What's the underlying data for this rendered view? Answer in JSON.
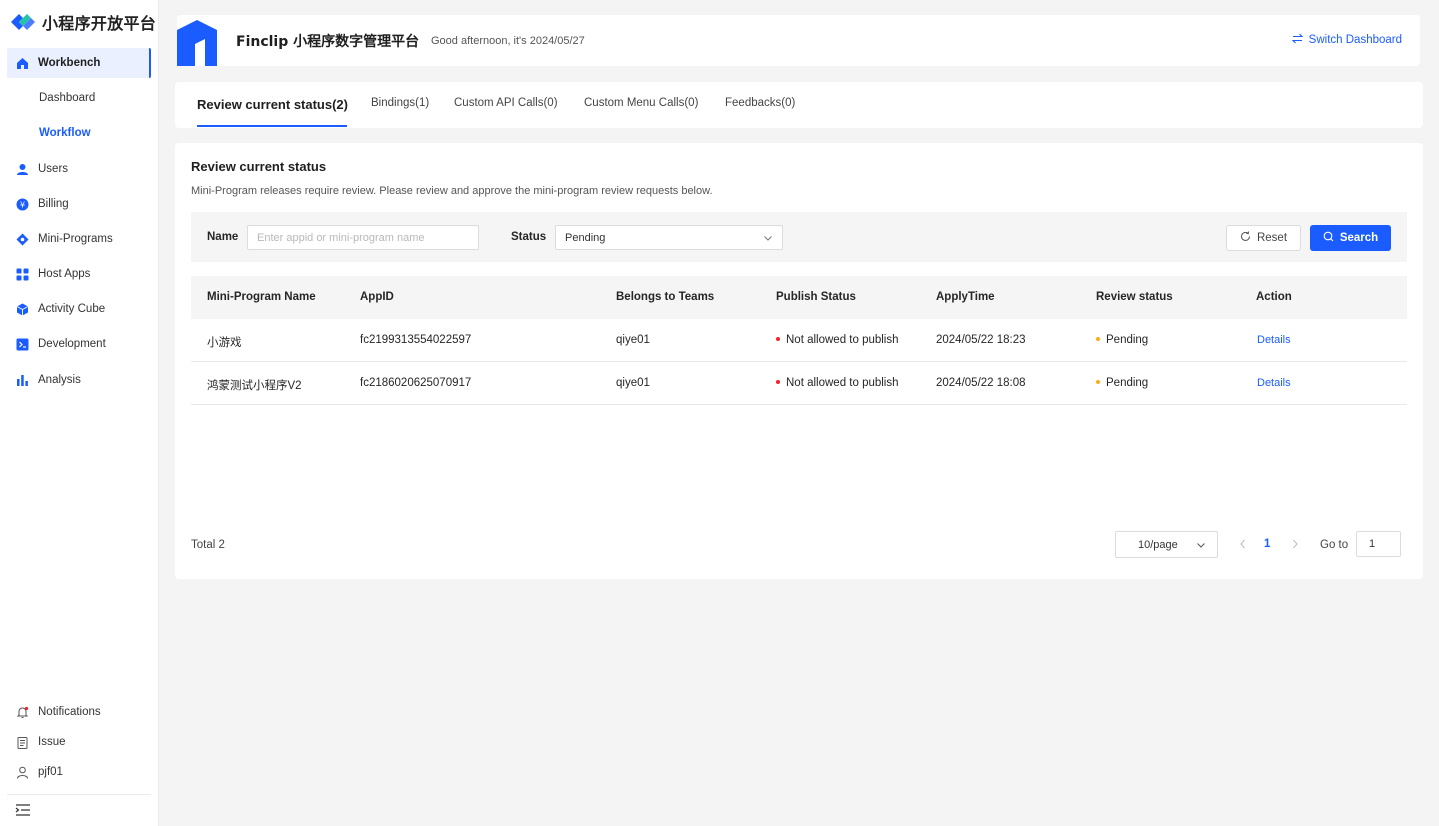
{
  "app": {
    "logo_text": "小程序开放平台"
  },
  "sidebar": {
    "workbench": "Workbench",
    "dashboard": "Dashboard",
    "workflow": "Workflow",
    "items": [
      {
        "label": "Users",
        "icon": "users-icon"
      },
      {
        "label": "Billing",
        "icon": "billing-icon"
      },
      {
        "label": "Mini-Programs",
        "icon": "mini-programs-icon"
      },
      {
        "label": "Host Apps",
        "icon": "host-apps-icon"
      },
      {
        "label": "Activity Cube",
        "icon": "cube-icon"
      },
      {
        "label": "Development",
        "icon": "terminal-icon"
      },
      {
        "label": "Analysis",
        "icon": "bar-chart-icon"
      }
    ],
    "bottom": [
      {
        "label": "Notifications",
        "icon": "bell-icon"
      },
      {
        "label": "Issue",
        "icon": "clipboard-icon"
      },
      {
        "label": "pjf01",
        "icon": "user-icon"
      }
    ]
  },
  "header": {
    "title": "Finclip 小程序数字管理平台",
    "greeting": "Good afternoon, it's  2024/05/27",
    "switch_label": "Switch Dashboard"
  },
  "tabs": [
    {
      "label": "Review current status(2)",
      "active": true
    },
    {
      "label": "Bindings(1)"
    },
    {
      "label": "Custom API Calls(0)"
    },
    {
      "label": "Custom Menu Calls(0)"
    },
    {
      "label": "Feedbacks(0)"
    }
  ],
  "section": {
    "title": "Review current status",
    "description": "Mini-Program releases require review. Please review and approve the mini-program review requests below."
  },
  "filters": {
    "name_label": "Name",
    "name_placeholder": "Enter appid or mini-program name",
    "status_label": "Status",
    "status_value": "Pending",
    "reset_label": "Reset",
    "search_label": "Search"
  },
  "table": {
    "columns": [
      "Mini-Program Name",
      "AppID",
      "Belongs to Teams",
      "Publish Status",
      "ApplyTime",
      "Review status",
      "Action"
    ],
    "rows": [
      {
        "name": "小游戏",
        "appid": "fc2199313554022597",
        "team": "qiye01",
        "publish": "Not allowed to publish",
        "apply_time": "2024/05/22 18:23",
        "review": "Pending",
        "action": "Details"
      },
      {
        "name": "鸿蒙测试小程序V2",
        "appid": "fc2186020625070917",
        "team": "qiye01",
        "publish": "Not allowed to publish",
        "apply_time": "2024/05/22 18:08",
        "review": "Pending",
        "action": "Details"
      }
    ]
  },
  "pagination": {
    "total": "Total 2",
    "page_size": "10/page",
    "current_page": "1",
    "goto_label": "Go to",
    "goto_value": "1"
  },
  "colors": {
    "primary": "#1a5cff",
    "publish_dot": "#f5222d",
    "pending_dot": "#faad14"
  }
}
